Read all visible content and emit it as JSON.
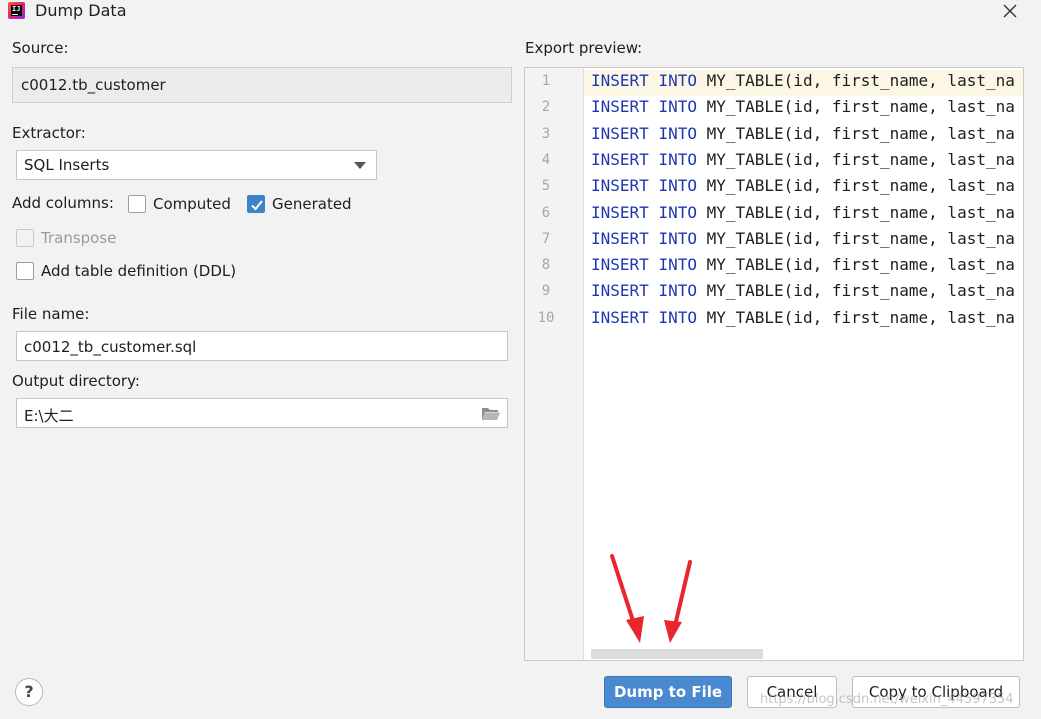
{
  "window": {
    "title": "Dump Data"
  },
  "source": {
    "label": "Source:",
    "value": "c0012.tb_customer"
  },
  "extractor": {
    "label": "Extractor:",
    "selected": "SQL Inserts"
  },
  "add_columns": {
    "label": "Add columns:",
    "computed_label": "Computed",
    "computed_checked": false,
    "generated_label": "Generated",
    "generated_checked": true
  },
  "transpose": {
    "label": "Transpose",
    "checked": false,
    "enabled": false
  },
  "ddl": {
    "label": "Add table definition (DDL)",
    "checked": false
  },
  "file_name": {
    "label": "File name:",
    "value": "c0012_tb_customer.sql"
  },
  "output_dir": {
    "label": "Output directory:",
    "value": "E:\\大二"
  },
  "preview": {
    "label": "Export preview:",
    "lines": [
      {
        "num": "1",
        "kw1": "INSERT",
        "kw2": "INTO",
        "rest": "MY_TABLE(id, first_name, last_na"
      },
      {
        "num": "2",
        "kw1": "INSERT",
        "kw2": "INTO",
        "rest": "MY_TABLE(id, first_name, last_na"
      },
      {
        "num": "3",
        "kw1": "INSERT",
        "kw2": "INTO",
        "rest": "MY_TABLE(id, first_name, last_na"
      },
      {
        "num": "4",
        "kw1": "INSERT",
        "kw2": "INTO",
        "rest": "MY_TABLE(id, first_name, last_na"
      },
      {
        "num": "5",
        "kw1": "INSERT",
        "kw2": "INTO",
        "rest": "MY_TABLE(id, first_name, last_na"
      },
      {
        "num": "6",
        "kw1": "INSERT",
        "kw2": "INTO",
        "rest": "MY_TABLE(id, first_name, last_na"
      },
      {
        "num": "7",
        "kw1": "INSERT",
        "kw2": "INTO",
        "rest": "MY_TABLE(id, first_name, last_na"
      },
      {
        "num": "8",
        "kw1": "INSERT",
        "kw2": "INTO",
        "rest": "MY_TABLE(id, first_name, last_na"
      },
      {
        "num": "9",
        "kw1": "INSERT",
        "kw2": "INTO",
        "rest": "MY_TABLE(id, first_name, last_na"
      },
      {
        "num": "10",
        "kw1": "INSERT",
        "kw2": "INTO",
        "rest": "MY_TABLE(id, first_name, last_na"
      }
    ]
  },
  "buttons": {
    "help": "?",
    "dump": "Dump to File",
    "cancel": "Cancel",
    "copy": "Copy to Clipboard"
  },
  "watermark": "https://blog.csdn.net/weixin_44597354",
  "colors": {
    "primary_button": "#4a88cf",
    "keyword": "#1e36b5",
    "checkbox_checked": "#3c83c8",
    "annotation_arrow": "#e8262b"
  },
  "icons": {
    "app": "intellij-app-icon",
    "close": "close-icon",
    "dropdown": "chevron-down-icon",
    "folder": "folder-open-icon",
    "help": "help-icon",
    "annotation": "red-arrow-icon"
  }
}
